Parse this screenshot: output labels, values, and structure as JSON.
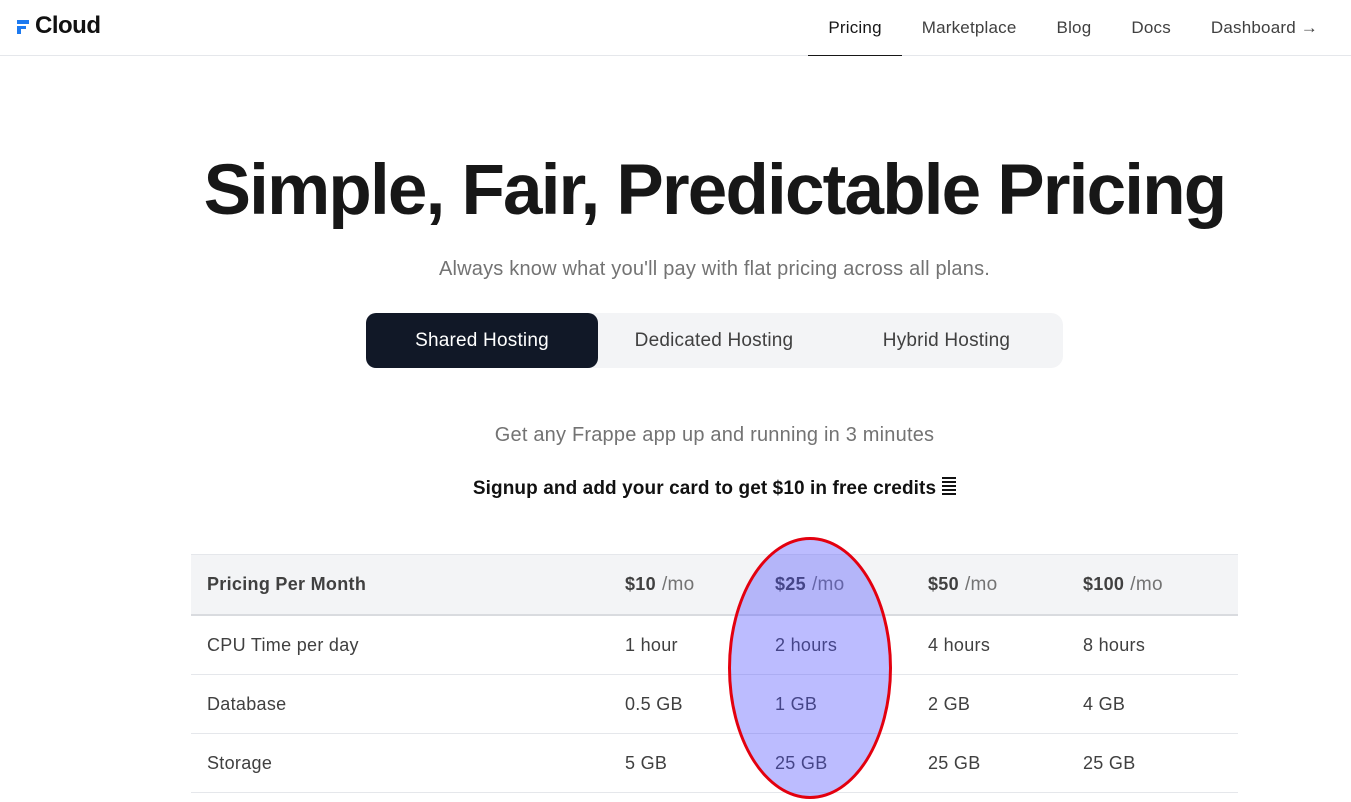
{
  "nav": {
    "logo_text": "Cloud",
    "links": [
      "Pricing",
      "Marketplace",
      "Blog",
      "Docs",
      "Dashboard →"
    ],
    "active": "Pricing"
  },
  "hero": {
    "title": "Simple, Fair, Predictable Pricing",
    "subtitle": "Always know what you'll pay with flat pricing across all plans."
  },
  "tabs": [
    "Shared Hosting",
    "Dedicated Hosting",
    "Hybrid Hosting"
  ],
  "active_tab": "Shared Hosting",
  "lead": "Get any Frappe app up and running in 3 minutes",
  "promo": "Signup and add your card to get $10 in free credits",
  "table": {
    "header": {
      "label": "Pricing Per Month",
      "plans": [
        {
          "price": "$10",
          "per": "/mo"
        },
        {
          "price": "$25",
          "per": "/mo"
        },
        {
          "price": "$50",
          "per": "/mo"
        },
        {
          "price": "$100",
          "per": "/mo"
        }
      ]
    },
    "rows": [
      {
        "label": "CPU Time per day",
        "values": [
          "1 hour",
          "2 hours",
          "4 hours",
          "8 hours"
        ]
      },
      {
        "label": "Database",
        "values": [
          "0.5 GB",
          "1 GB",
          "2 GB",
          "4 GB"
        ]
      },
      {
        "label": "Storage",
        "values": [
          "5 GB",
          "25 GB",
          "25 GB",
          "25 GB"
        ]
      }
    ]
  },
  "colors": {
    "brand": "#1d7af0",
    "active_tab_bg": "#111827",
    "highlight_fill": "#5050ff",
    "highlight_stroke": "#e3000f"
  }
}
